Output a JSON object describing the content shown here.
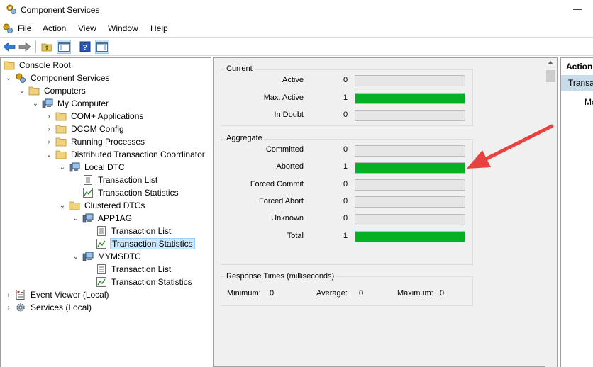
{
  "window": {
    "title": "Component Services"
  },
  "menu": [
    "File",
    "Action",
    "View",
    "Window",
    "Help"
  ],
  "tree": {
    "console_root": "Console Root",
    "component_services": "Component Services",
    "computers": "Computers",
    "my_computer": "My Computer",
    "com_apps": "COM+ Applications",
    "dcom_config": "DCOM Config",
    "running_processes": "Running Processes",
    "dtc": "Distributed Transaction Coordinator",
    "local_dtc": "Local DTC",
    "local_tx_list": "Transaction List",
    "local_tx_stats": "Transaction Statistics",
    "clustered_dtcs": "Clustered DTCs",
    "app1ag": "APP1AG",
    "app1ag_tx_list": "Transaction List",
    "app1ag_tx_stats": "Transaction Statistics",
    "mymsdtc": "MYMSDTC",
    "mymsdtc_tx_list": "Transaction List",
    "mymsdtc_tx_stats": "Transaction Statistics",
    "event_viewer": "Event Viewer (Local)",
    "services": "Services (Local)"
  },
  "stats": {
    "current": {
      "title": "Current",
      "rows": [
        {
          "label": "Active",
          "value": "0",
          "fill": 0
        },
        {
          "label": "Max. Active",
          "value": "1",
          "fill": 1
        },
        {
          "label": "In Doubt",
          "value": "0",
          "fill": 0
        }
      ]
    },
    "aggregate": {
      "title": "Aggregate",
      "rows": [
        {
          "label": "Committed",
          "value": "0",
          "fill": 0
        },
        {
          "label": "Aborted",
          "value": "1",
          "fill": 1
        },
        {
          "label": "Forced Commit",
          "value": "0",
          "fill": 0
        },
        {
          "label": "Forced Abort",
          "value": "0",
          "fill": 0
        },
        {
          "label": "Unknown",
          "value": "0",
          "fill": 0
        },
        {
          "label": "Total",
          "value": "1",
          "fill": 1
        }
      ]
    },
    "response_times": {
      "title": "Response Times (milliseconds)",
      "minimum_label": "Minimum:",
      "minimum_value": "0",
      "average_label": "Average:",
      "average_value": "0",
      "maximum_label": "Maximum:",
      "maximum_value": "0"
    }
  },
  "actions": {
    "header": "Actions",
    "subheader": "Transaction Statistics",
    "item": "More Actions"
  },
  "colors": {
    "bar_fill": "#06b025",
    "arrow": "#e8413e",
    "selection": "#cce8ff"
  }
}
